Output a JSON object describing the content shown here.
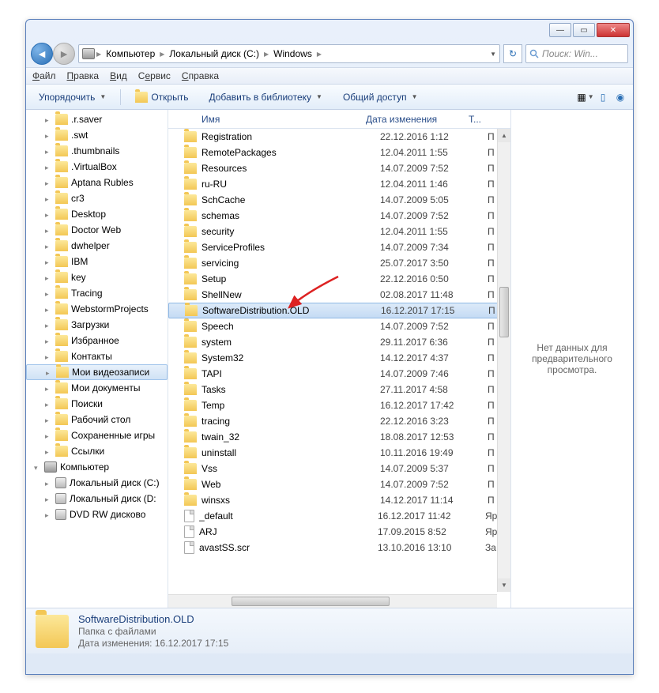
{
  "titlebar": {
    "min": "—",
    "max": "▭",
    "close": "✕"
  },
  "breadcrumb": {
    "root": "Компьютер",
    "disk": "Локальный диск (C:)",
    "folder": "Windows"
  },
  "search": {
    "placeholder": "Поиск: Win..."
  },
  "menu": {
    "file": "Файл",
    "edit": "Правка",
    "view": "Вид",
    "tools": "Сервис",
    "help": "Справка"
  },
  "toolbar": {
    "organize": "Упорядочить",
    "open": "Открыть",
    "addlib": "Добавить в библиотеку",
    "share": "Общий доступ"
  },
  "headers": {
    "name": "Имя",
    "date": "Дата изменения",
    "type": "Т..."
  },
  "preview": {
    "nodata": "Нет данных для предварительного просмотра."
  },
  "details": {
    "name": "SoftwareDistribution.OLD",
    "kind": "Папка с файлами",
    "mlabel": "Дата изменения:",
    "mdate": "16.12.2017 17:15"
  },
  "tree": [
    {
      "l": ".r.saver",
      "d": 1
    },
    {
      "l": ".swt",
      "d": 1
    },
    {
      "l": ".thumbnails",
      "d": 1
    },
    {
      "l": ".VirtualBox",
      "d": 1
    },
    {
      "l": "Aptana Rubles",
      "d": 1
    },
    {
      "l": "cr3",
      "d": 1
    },
    {
      "l": "Desktop",
      "d": 1
    },
    {
      "l": "Doctor Web",
      "d": 1
    },
    {
      "l": "dwhelper",
      "d": 1
    },
    {
      "l": "IBM",
      "d": 1
    },
    {
      "l": "key",
      "d": 1
    },
    {
      "l": "Tracing",
      "d": 1
    },
    {
      "l": "WebstormProjects",
      "d": 1
    },
    {
      "l": "Загрузки",
      "d": 1
    },
    {
      "l": "Избранное",
      "d": 1
    },
    {
      "l": "Контакты",
      "d": 1
    },
    {
      "l": "Мои видеозаписи",
      "d": 1,
      "sel": true
    },
    {
      "l": "Мои документы",
      "d": 1
    },
    {
      "l": "Поиски",
      "d": 1
    },
    {
      "l": "Рабочий стол",
      "d": 1
    },
    {
      "l": "Сохраненные игры",
      "d": 1
    },
    {
      "l": "Ссылки",
      "d": 1
    },
    {
      "l": "Компьютер",
      "d": 0,
      "comp": true,
      "exp": true
    },
    {
      "l": "Локальный диск (C:)",
      "d": 1,
      "disk": true
    },
    {
      "l": "Локальный диск (D:",
      "d": 1,
      "disk": true
    },
    {
      "l": "DVD RW дисково",
      "d": 1,
      "disk": true
    }
  ],
  "rows": [
    {
      "n": "Registration",
      "d": "22.12.2016 1:12",
      "t": "П"
    },
    {
      "n": "RemotePackages",
      "d": "12.04.2011 1:55",
      "t": "П"
    },
    {
      "n": "Resources",
      "d": "14.07.2009 7:52",
      "t": "П"
    },
    {
      "n": "ru-RU",
      "d": "12.04.2011 1:46",
      "t": "П"
    },
    {
      "n": "SchCache",
      "d": "14.07.2009 5:05",
      "t": "П"
    },
    {
      "n": "schemas",
      "d": "14.07.2009 7:52",
      "t": "П"
    },
    {
      "n": "security",
      "d": "12.04.2011 1:55",
      "t": "П"
    },
    {
      "n": "ServiceProfiles",
      "d": "14.07.2009 7:34",
      "t": "П"
    },
    {
      "n": "servicing",
      "d": "25.07.2017 3:50",
      "t": "П"
    },
    {
      "n": "Setup",
      "d": "22.12.2016 0:50",
      "t": "П"
    },
    {
      "n": "ShellNew",
      "d": "02.08.2017 11:48",
      "t": "П"
    },
    {
      "n": "SoftwareDistribution.OLD",
      "d": "16.12.2017 17:15",
      "t": "П",
      "sel": true
    },
    {
      "n": "Speech",
      "d": "14.07.2009 7:52",
      "t": "П"
    },
    {
      "n": "system",
      "d": "29.11.2017 6:36",
      "t": "П"
    },
    {
      "n": "System32",
      "d": "14.12.2017 4:37",
      "t": "П"
    },
    {
      "n": "TAPI",
      "d": "14.07.2009 7:46",
      "t": "П"
    },
    {
      "n": "Tasks",
      "d": "27.11.2017 4:58",
      "t": "П"
    },
    {
      "n": "Temp",
      "d": "16.12.2017 17:42",
      "t": "П"
    },
    {
      "n": "tracing",
      "d": "22.12.2016 3:23",
      "t": "П"
    },
    {
      "n": "twain_32",
      "d": "18.08.2017 12:53",
      "t": "П"
    },
    {
      "n": "uninstall",
      "d": "10.11.2016 19:49",
      "t": "П"
    },
    {
      "n": "Vss",
      "d": "14.07.2009 5:37",
      "t": "П"
    },
    {
      "n": "Web",
      "d": "14.07.2009 7:52",
      "t": "П"
    },
    {
      "n": "winsxs",
      "d": "14.12.2017 11:14",
      "t": "П"
    },
    {
      "n": "_default",
      "d": "16.12.2017 11:42",
      "t": "Яр",
      "file": true
    },
    {
      "n": "ARJ",
      "d": "17.09.2015 8:52",
      "t": "Яр",
      "file": true
    },
    {
      "n": "avastSS.scr",
      "d": "13.10.2016 13:10",
      "t": "За",
      "file": true
    }
  ]
}
